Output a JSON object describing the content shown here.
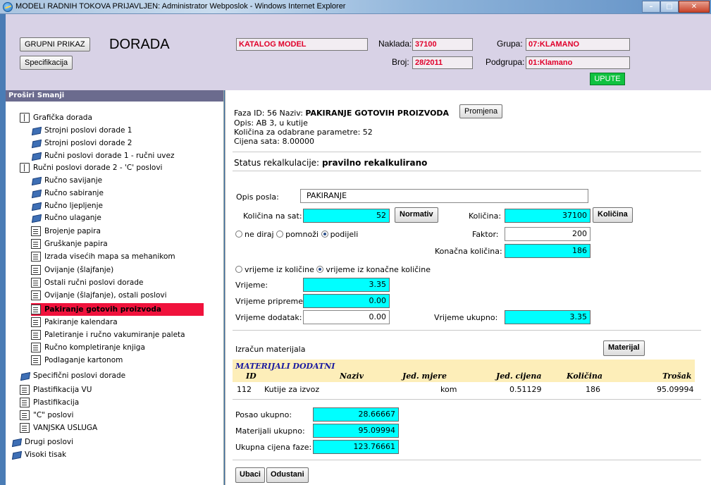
{
  "window": {
    "title": "MODELI RADNIH TOKOVA  PRIJAVLJEN: Administrator  Webposlok  - Windows Internet Explorer",
    "btn_minimize": "–",
    "btn_maximize": "□",
    "btn_close": "✕"
  },
  "header": {
    "grupni_prikaz": "GRUPNI PRIKAZ",
    "app_title": "DORADA",
    "specifikacija": "Specifikacija",
    "katalog_model": "KATALOG MODEL",
    "naklada_label": "Naklada:",
    "naklada_value": "37100",
    "grupa_label": "Grupa:",
    "grupa_value": "07:KLAMANO",
    "broj_label": "Broj:",
    "broj_value": "28/2011",
    "podgrupa_label": "Podgrupa:",
    "podgrupa_value": "01:Klamano",
    "upute": "UPUTE"
  },
  "tree": {
    "prosiri": "Proširi",
    "smanji": "Smanji",
    "items": [
      {
        "label": "Grafička dorada",
        "icon": "folder"
      },
      {
        "label": "Strojni poslovi dorade 1",
        "icon": "diamond"
      },
      {
        "label": "Strojni poslovi dorade 2",
        "icon": "diamond"
      },
      {
        "label": "Ručni poslovi dorade 1 - ručni uvez",
        "icon": "diamond"
      },
      {
        "label": "Ručni poslovi dorade 2 - 'C' poslovi",
        "icon": "folder"
      },
      {
        "label": "Ručno savijanje",
        "icon": "diamond"
      },
      {
        "label": "Ručno sabiranje",
        "icon": "diamond"
      },
      {
        "label": "Ručno ljepljenje",
        "icon": "diamond"
      },
      {
        "label": "Ručno ulaganje",
        "icon": "diamond"
      },
      {
        "label": "Brojenje papira",
        "icon": "page"
      },
      {
        "label": "Gruškanje papira",
        "icon": "page"
      },
      {
        "label": "Izrada visećih mapa sa mehanikom",
        "icon": "page"
      },
      {
        "label": "Ovijanje (šlajfanje)",
        "icon": "page"
      },
      {
        "label": "Ostali ručni poslovi dorade",
        "icon": "page"
      },
      {
        "label": "Ovijanje (šlajfanje), ostali poslovi",
        "icon": "page"
      },
      {
        "label": "Pakiranje gotovih proizvoda",
        "icon": "page"
      },
      {
        "label": "Pakiranje kalendara",
        "icon": "page"
      },
      {
        "label": "Paletiranje i ručno vakumiranje paleta",
        "icon": "page"
      },
      {
        "label": "Ručno kompletiranje knjiga",
        "icon": "page"
      },
      {
        "label": "Podlaganje kartonom",
        "icon": "page"
      },
      {
        "label": "Specifični poslovi dorade",
        "icon": "diamond"
      },
      {
        "label": "Plastifikacija VU",
        "icon": "page"
      },
      {
        "label": "Plastifikacija",
        "icon": "page"
      },
      {
        "label": "\"C\" poslovi",
        "icon": "page"
      },
      {
        "label": "VANJSKA USLUGA",
        "icon": "page"
      },
      {
        "label": "Drugi poslovi",
        "icon": "diamond"
      },
      {
        "label": "Visoki tisak",
        "icon": "diamond"
      }
    ]
  },
  "main": {
    "faza_id_label": "Faza ID: 56  Naziv:",
    "faza_naziv": "PAKIRANJE GOTOVIH PROIZVODA",
    "promjena": "Promjena",
    "opis": "Opis: AB 3, u kutije",
    "kolicina_param": "Količina za odabrane parametre: 52",
    "cijena_sata": "Cijena sata: 8.00000",
    "status_label": "Status rekalkulacije:",
    "status_value": "pravilno rekalkulirano",
    "opis_posla_label": "Opis posla:",
    "opis_posla_value": "PAKIRANJE",
    "kolicina_na_sat_label": "Količina na sat:",
    "kolicina_na_sat_value": "52",
    "normativ": "Normativ",
    "kolicina_label": "Količina:",
    "kolicina_value": "37100",
    "kolicina_btn": "Količina",
    "radio_ne_diraj": "ne diraj",
    "radio_pomnozi": "pomnoži",
    "radio_podijeli": "podijeli",
    "faktor_label": "Faktor:",
    "faktor_value": "200",
    "konacna_label": "Konačna količina:",
    "konacna_value": "186",
    "radio_vrijeme_kol": "vrijeme iz količine",
    "radio_vrijeme_konacne": "vrijeme iz konačne količine",
    "vrijeme_label": "Vrijeme:",
    "vrijeme_value": "3.35",
    "vrijeme_pripreme_label": "Vrijeme pripreme:",
    "vrijeme_pripreme_value": "0.00",
    "vrijeme_dodatak_label": "Vrijeme dodatak:",
    "vrijeme_dodatak_value": "0.00",
    "vrijeme_ukupno_label": "Vrijeme ukupno:",
    "vrijeme_ukupno_value": "3.35",
    "izracun_label": "Izračun materijala",
    "materijal_btn": "Materijal",
    "materijali_title": "MATERIJALI DODATNI",
    "table_headers": [
      "ID",
      "Naziv",
      "Jed. mjere",
      "Jed. cijena",
      "Količina",
      "Trošak"
    ],
    "table_row": [
      "112",
      "Kutije za izvoz",
      "kom",
      "0.51129",
      "186",
      "95.09994"
    ],
    "posao_ukupno_label": "Posao ukupno:",
    "posao_ukupno_value": "28.66667",
    "materijali_ukupno_label": "Materijali ukupno:",
    "materijali_ukupno_value": "95.09994",
    "ukupna_cijena_label": "Ukupna cijena faze:",
    "ukupna_cijena_value": "123.76661",
    "ubaci": "Ubaci",
    "odustani": "Odustani"
  },
  "colors": {
    "header_bg": "#d8d2e6",
    "accent_red": "#e0002a",
    "selected_row": "#f0123c",
    "cyan_field": "#00ffff",
    "upute_green": "#10c240",
    "table_header_bg": "#fdeeb9"
  }
}
